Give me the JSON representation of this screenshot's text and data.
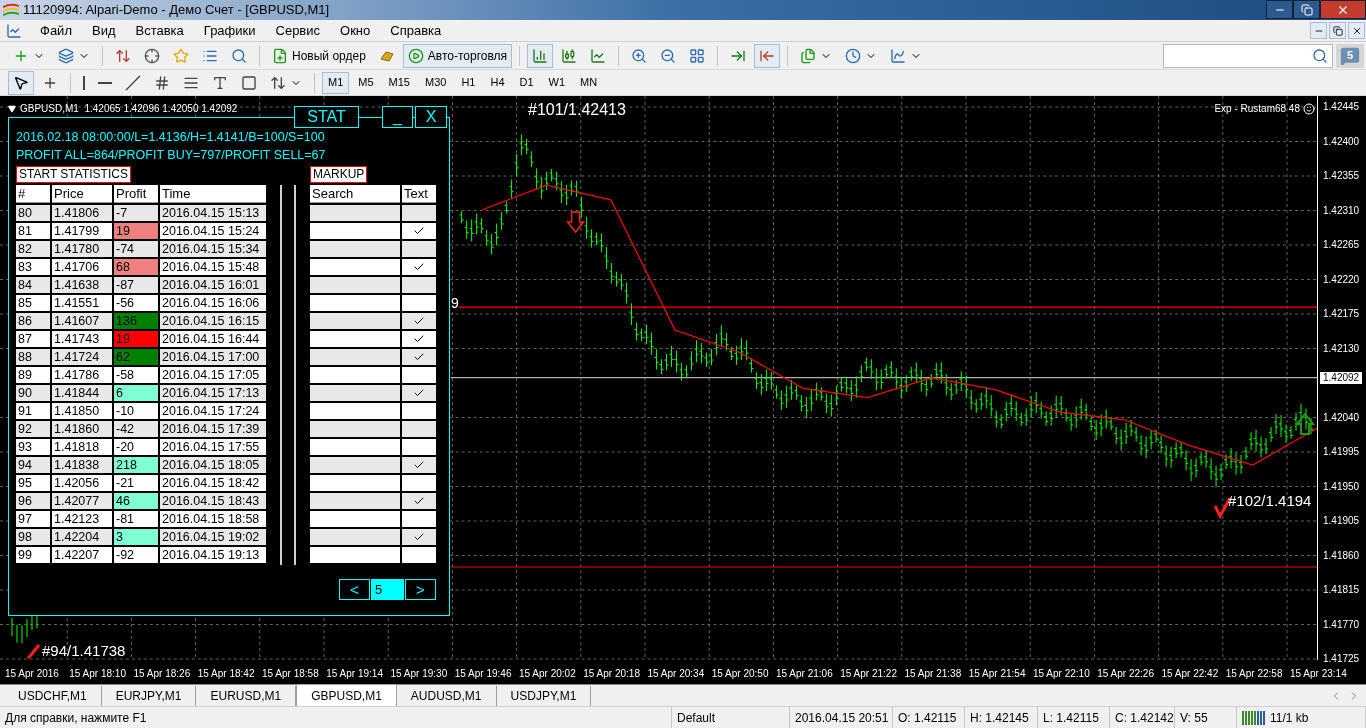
{
  "window": {
    "title": "11120994: Alpari-Demo - Демо Счет - [GBPUSD,M1]"
  },
  "menu": [
    "Файл",
    "Вид",
    "Вставка",
    "Графики",
    "Сервис",
    "Окно",
    "Справка"
  ],
  "toolbar": [
    {
      "kind": "new-chart",
      "pressed": false
    },
    {
      "kind": "profiles",
      "pressed": false
    },
    {
      "kind": "separator"
    },
    {
      "kind": "market-watch",
      "pressed": false
    },
    {
      "kind": "navigator",
      "pressed": false
    },
    {
      "kind": "favorites",
      "pressed": false
    },
    {
      "kind": "terminal",
      "pressed": false
    },
    {
      "kind": "tester",
      "pressed": false
    },
    {
      "kind": "separator"
    },
    {
      "kind": "new-order",
      "label": "Новый ордер",
      "pressed": false
    },
    {
      "kind": "gold",
      "pressed": false
    },
    {
      "kind": "auto-trading",
      "label": "Авто-торговля",
      "pressed": true
    },
    {
      "kind": "separator"
    },
    {
      "kind": "bars",
      "pressed": true
    },
    {
      "kind": "candles",
      "pressed": false
    },
    {
      "kind": "line",
      "pressed": false
    },
    {
      "kind": "separator"
    },
    {
      "kind": "zoom-in",
      "pressed": false
    },
    {
      "kind": "zoom-out",
      "pressed": false
    },
    {
      "kind": "tile",
      "pressed": false
    },
    {
      "kind": "separator"
    },
    {
      "kind": "chart-shift",
      "pressed": false
    },
    {
      "kind": "autoscroll",
      "pressed": true
    },
    {
      "kind": "separator"
    },
    {
      "kind": "templates",
      "pressed": false
    },
    {
      "kind": "periods",
      "pressed": false
    },
    {
      "kind": "indicators",
      "pressed": false
    }
  ],
  "search": {
    "badge": "5"
  },
  "tools": [
    {
      "kind": "cursor",
      "pressed": true
    },
    {
      "kind": "crosshair",
      "pressed": false
    },
    {
      "kind": "separator"
    },
    {
      "kind": "vline",
      "pressed": false
    },
    {
      "kind": "hline",
      "pressed": false
    },
    {
      "kind": "trendline",
      "pressed": false
    },
    {
      "kind": "channel",
      "pressed": false
    },
    {
      "kind": "fibo",
      "pressed": false
    },
    {
      "kind": "text",
      "pressed": false
    },
    {
      "kind": "label",
      "pressed": false
    },
    {
      "kind": "arrows",
      "pressed": false
    }
  ],
  "timeframes": [
    {
      "label": "M1",
      "selected": true
    },
    {
      "label": "M5",
      "selected": false
    },
    {
      "label": "M15",
      "selected": false
    },
    {
      "label": "M30",
      "selected": false
    },
    {
      "label": "H1",
      "selected": false
    },
    {
      "label": "H4",
      "selected": false
    },
    {
      "label": "D1",
      "selected": false
    },
    {
      "label": "W1",
      "selected": false
    },
    {
      "label": "MN",
      "selected": false
    }
  ],
  "chart": {
    "header": "GBPUSD,M1  1.42065 1.42096 1.42050 1.42092",
    "expert": "Exp - Rustam68 48",
    "annotations": [
      {
        "text": "#101/1.42413"
      },
      {
        "text": "#102/1.4194"
      },
      {
        "text": "#94/1.41738"
      },
      {
        "text": "9"
      }
    ],
    "chart_data": {
      "type": "line",
      "grid": true,
      "ref_lines": [
        {
          "axis": "y",
          "value": 1.42184,
          "color": "#ff0000"
        },
        {
          "axis": "y",
          "value": 1.42092,
          "color": "#b0b0b0",
          "label": "1.42092"
        },
        {
          "axis": "y",
          "value": 1.41845,
          "color": "#ff0000"
        }
      ],
      "categories": [
        "15 Apr 2016",
        "15 Apr 18:10",
        "15 Apr 18:26",
        "15 Apr 18:42",
        "15 Apr 18:58",
        "15 Apr 19:14",
        "15 Apr 19:30",
        "15 Apr 19:46",
        "15 Apr 20:02",
        "15 Apr 20:18",
        "15 Apr 20:34",
        "15 Apr 20:50",
        "15 Apr 21:06",
        "15 Apr 21:22",
        "15 Apr 21:38",
        "15 Apr 21:54",
        "15 Apr 22:10",
        "15 Apr 22:26",
        "15 Apr 22:42",
        "15 Apr 22:58",
        "15 Apr 23:14"
      ],
      "series": [
        {
          "color": "#ff0000",
          "values": [
            null,
            null,
            null,
            null,
            null,
            null,
            null,
            1.42311,
            1.42343,
            1.42324,
            1.42154,
            1.42125,
            1.42078,
            1.42066,
            1.42092,
            1.42076,
            1.42047,
            1.42037,
            1.42004,
            1.41978,
            1.42026
          ]
        }
      ],
      "ylim": [
        1.41725,
        1.42445
      ],
      "yticks": [
        {
          "value": 1.42445,
          "label": "1.42445"
        },
        {
          "value": 1.424,
          "label": "1.42400"
        },
        {
          "value": 1.42355,
          "label": "1.42355"
        },
        {
          "value": 1.4231,
          "label": "1.42310"
        },
        {
          "value": 1.42265,
          "label": "1.42265"
        },
        {
          "value": 1.4222,
          "label": "1.42220"
        },
        {
          "value": 1.42175,
          "label": "1.42175"
        },
        {
          "value": 1.4213,
          "label": "1.42130"
        },
        {
          "value": 1.4204,
          "label": "1.42040"
        },
        {
          "value": 1.41995,
          "label": "1.41995"
        },
        {
          "value": 1.4195,
          "label": "1.41950"
        },
        {
          "value": 1.41905,
          "label": "1.41905"
        },
        {
          "value": 1.4186,
          "label": "1.41860"
        },
        {
          "value": 1.41815,
          "label": "1.41815"
        },
        {
          "value": 1.4177,
          "label": "1.41770"
        },
        {
          "value": 1.41725,
          "label": "1.41725"
        }
      ]
    }
  },
  "stat_panel": {
    "title": "STAT",
    "minimize": "_",
    "close": "X",
    "info_lines": [
      "2016.02.18 08:00:00/L=1.4136/H=1.4141/B=100/S=100",
      "PROFIT ALL=864/PROFIT BUY=797/PROFIT SELL=67"
    ],
    "statistics": {
      "title": "START STATISTICS",
      "columns": [
        "#",
        "Price",
        "Profit",
        "Time"
      ],
      "rows": [
        {
          "cells": [
            "80",
            "1.41806",
            "-7",
            "2016.04.15 15:13"
          ]
        },
        {
          "cells": [
            "81",
            "1.41799",
            "19",
            "2016.04.15 15:24"
          ],
          "color": "#f08080"
        },
        {
          "cells": [
            "82",
            "1.41780",
            "-74",
            "2016.04.15 15:34"
          ]
        },
        {
          "cells": [
            "83",
            "1.41706",
            "68",
            "2016.04.15 15:48"
          ],
          "color": "#f08080"
        },
        {
          "cells": [
            "84",
            "1.41638",
            "-87",
            "2016.04.15 16:01"
          ]
        },
        {
          "cells": [
            "85",
            "1.41551",
            "-56",
            "2016.04.15 16:06"
          ]
        },
        {
          "cells": [
            "86",
            "1.41607",
            "136",
            "2016.04.15 16:15"
          ],
          "color": "#008000"
        },
        {
          "cells": [
            "87",
            "1.41743",
            "19",
            "2016.04.15 16:44"
          ],
          "color": "#ff0000"
        },
        {
          "cells": [
            "88",
            "1.41724",
            "62",
            "2016.04.15 17:00"
          ],
          "color": "#008000"
        },
        {
          "cells": [
            "89",
            "1.41786",
            "-58",
            "2016.04.15 17:05"
          ]
        },
        {
          "cells": [
            "90",
            "1.41844",
            "6",
            "2016.04.15 17:13"
          ],
          "color": "#7fffd4"
        },
        {
          "cells": [
            "91",
            "1.41850",
            "-10",
            "2016.04.15 17:24"
          ]
        },
        {
          "cells": [
            "92",
            "1.41860",
            "-42",
            "2016.04.15 17:39"
          ]
        },
        {
          "cells": [
            "93",
            "1.41818",
            "-20",
            "2016.04.15 17:55"
          ]
        },
        {
          "cells": [
            "94",
            "1.41838",
            "218",
            "2016.04.15 18:05"
          ],
          "color": "#7fffd4"
        },
        {
          "cells": [
            "95",
            "1.42056",
            "-21",
            "2016.04.15 18:42"
          ]
        },
        {
          "cells": [
            "96",
            "1.42077",
            "46",
            "2016.04.15 18:43"
          ],
          "color": "#7fffd4"
        },
        {
          "cells": [
            "97",
            "1.42123",
            "-81",
            "2016.04.15 18:58"
          ]
        },
        {
          "cells": [
            "98",
            "1.42204",
            "3",
            "2016.04.15 19:02"
          ],
          "color": "#7fffd4"
        },
        {
          "cells": [
            "99",
            "1.42207",
            "-92",
            "2016.04.15 19:13"
          ]
        }
      ]
    },
    "markup": {
      "title": "MARKUP",
      "columns": [
        "Search",
        "Text"
      ],
      "rows": [
        {
          "checked": false
        },
        {
          "checked": true
        },
        {
          "checked": false
        },
        {
          "checked": true
        },
        {
          "checked": false
        },
        {
          "checked": false
        },
        {
          "checked": true
        },
        {
          "checked": true
        },
        {
          "checked": true
        },
        {
          "checked": false
        },
        {
          "checked": true
        },
        {
          "checked": false
        },
        {
          "checked": false
        },
        {
          "checked": false
        },
        {
          "checked": true
        },
        {
          "checked": false
        },
        {
          "checked": true
        },
        {
          "checked": false
        },
        {
          "checked": true
        },
        {
          "checked": false
        }
      ]
    },
    "pager": {
      "prev": "<",
      "page": "5",
      "next": ">"
    }
  },
  "tabs": [
    {
      "label": "USDCHF,M1",
      "selected": false
    },
    {
      "label": "EURJPY,M1",
      "selected": false
    },
    {
      "label": "EURUSD,M1",
      "selected": false
    },
    {
      "label": "GBPUSD,M1",
      "selected": true
    },
    {
      "label": "AUDUSD,M1",
      "selected": false
    },
    {
      "label": "USDJPY,M1",
      "selected": false
    }
  ],
  "status_bar": [
    "Для справки, нажмите F1",
    "Default",
    "2016.04.15 20:51",
    "O: 1.42115",
    "H: 1.42145",
    "L: 1.42115",
    "C: 1.42142",
    "V: 55",
    "11/1 kb"
  ]
}
